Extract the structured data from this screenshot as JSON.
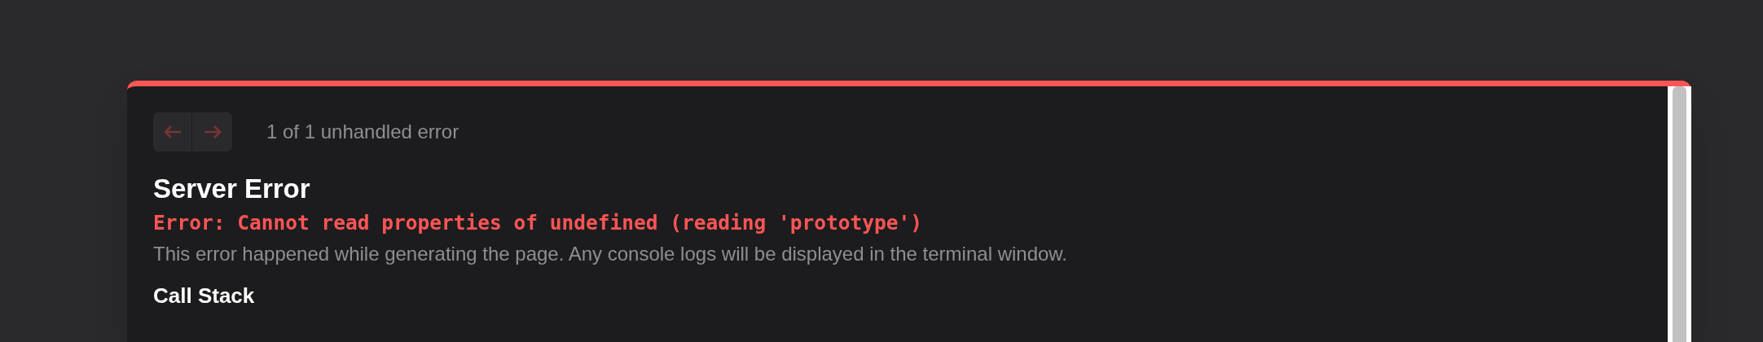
{
  "navigation": {
    "previous": {
      "disabled": true
    },
    "next": {
      "disabled": true
    },
    "counter": "1 of 1 unhandled error"
  },
  "title": "Server Error",
  "error_message": "Error: Cannot read properties of undefined (reading 'prototype')",
  "description": "This error happened while generating the page. Any console logs will be displayed in the terminal window.",
  "section_heading": "Call Stack"
}
